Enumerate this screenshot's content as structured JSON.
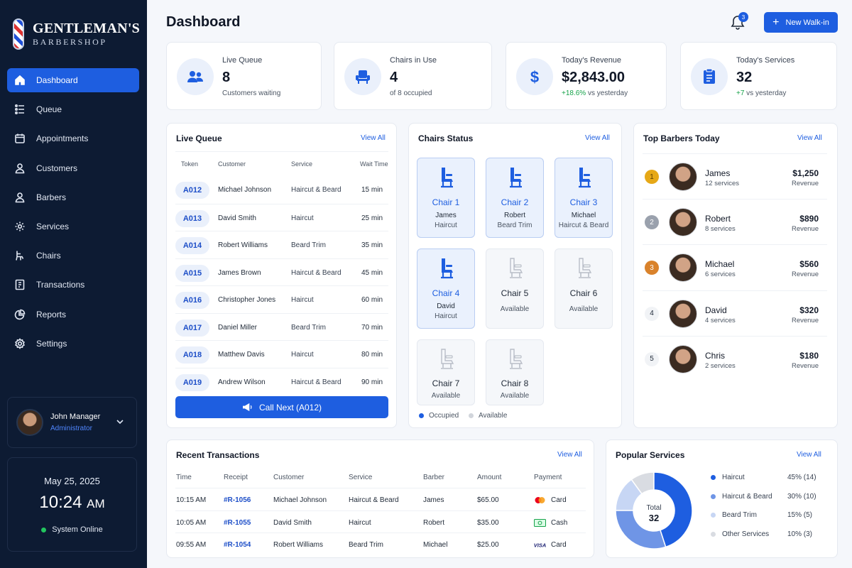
{
  "brand": {
    "title": "GENTLEMAN'S",
    "subtitle": "BARBERSHOP"
  },
  "nav": [
    {
      "label": "Dashboard",
      "icon": "home-icon",
      "active": true
    },
    {
      "label": "Queue",
      "icon": "list-icon"
    },
    {
      "label": "Appointments",
      "icon": "calendar-icon"
    },
    {
      "label": "Customers",
      "icon": "user-icon"
    },
    {
      "label": "Barbers",
      "icon": "user-icon"
    },
    {
      "label": "Services",
      "icon": "gear-icon"
    },
    {
      "label": "Chairs",
      "icon": "chair-icon"
    },
    {
      "label": "Transactions",
      "icon": "receipt-icon"
    },
    {
      "label": "Reports",
      "icon": "pie-chart-icon"
    },
    {
      "label": "Settings",
      "icon": "settings-icon"
    }
  ],
  "user": {
    "name": "John Manager",
    "role": "Administrator"
  },
  "clock": {
    "date": "May 25, 2025",
    "time": "10:24",
    "ampm": "AM",
    "status": "System Online"
  },
  "header": {
    "title": "Dashboard",
    "notifications": "3",
    "new_button": "New Walk-in"
  },
  "stats": [
    {
      "label": "Live Queue",
      "value": "8",
      "sub": "Customers waiting"
    },
    {
      "label": "Chairs in Use",
      "value": "4",
      "sub": "of 8 occupied"
    },
    {
      "label": "Today's Revenue",
      "value": "$2,843.00",
      "sub_green": "+18.6%",
      "sub": " vs yesterday"
    },
    {
      "label": "Today's Services",
      "value": "32",
      "sub_green": "+7",
      "sub": " vs yesterday"
    }
  ],
  "queue": {
    "title": "Live Queue",
    "view_all": "View All",
    "columns": [
      "Token",
      "Customer",
      "Service",
      "Wait Time"
    ],
    "rows": [
      {
        "token": "A012",
        "customer": "Michael Johnson",
        "service": "Haircut & Beard",
        "wait": "15 min"
      },
      {
        "token": "A013",
        "customer": "David Smith",
        "service": "Haircut",
        "wait": "25 min"
      },
      {
        "token": "A014",
        "customer": "Robert Williams",
        "service": "Beard Trim",
        "wait": "35 min"
      },
      {
        "token": "A015",
        "customer": "James Brown",
        "service": "Haircut & Beard",
        "wait": "45 min"
      },
      {
        "token": "A016",
        "customer": "Christopher Jones",
        "service": "Haircut",
        "wait": "60 min"
      },
      {
        "token": "A017",
        "customer": "Daniel Miller",
        "service": "Beard Trim",
        "wait": "70 min"
      },
      {
        "token": "A018",
        "customer": "Matthew Davis",
        "service": "Haircut",
        "wait": "80 min"
      },
      {
        "token": "A019",
        "customer": "Andrew Wilson",
        "service": "Haircut & Beard",
        "wait": "90 min"
      }
    ],
    "call_next": "Call Next (A012)"
  },
  "chairs": {
    "title": "Chairs Status",
    "view_all": "View All",
    "items": [
      {
        "name": "Chair 1",
        "line1": "James",
        "line2": "Haircut",
        "occupied": true
      },
      {
        "name": "Chair 2",
        "line1": "Robert",
        "line2": "Beard Trim",
        "occupied": true
      },
      {
        "name": "Chair 3",
        "line1": "Michael",
        "line2": "Haircut & Beard",
        "occupied": true
      },
      {
        "name": "Chair 4",
        "line1": "David",
        "line2": "Haircut",
        "occupied": true
      },
      {
        "name": "Chair 5",
        "line1": "Available",
        "occupied": false
      },
      {
        "name": "Chair 6",
        "line1": "Available",
        "occupied": false
      },
      {
        "name": "Chair 7",
        "line1": "Available",
        "occupied": false
      },
      {
        "name": "Chair 8",
        "line1": "Available",
        "occupied": false
      }
    ],
    "legend": {
      "occupied": "Occupied",
      "available": "Available"
    }
  },
  "barbers": {
    "title": "Top Barbers Today",
    "view_all": "View All",
    "rows": [
      {
        "rank": "1",
        "name": "James",
        "services": "12 services",
        "revenue": "$1,250",
        "revenue_label": "Revenue"
      },
      {
        "rank": "2",
        "name": "Robert",
        "services": "8 services",
        "revenue": "$890",
        "revenue_label": "Revenue"
      },
      {
        "rank": "3",
        "name": "Michael",
        "services": "6 services",
        "revenue": "$560",
        "revenue_label": "Revenue"
      },
      {
        "rank": "4",
        "name": "David",
        "services": "4 services",
        "revenue": "$320",
        "revenue_label": "Revenue"
      },
      {
        "rank": "5",
        "name": "Chris",
        "services": "2 services",
        "revenue": "$180",
        "revenue_label": "Revenue"
      }
    ]
  },
  "transactions": {
    "title": "Recent Transactions",
    "view_all": "View All",
    "columns": [
      "Time",
      "Receipt",
      "Customer",
      "Service",
      "Barber",
      "Amount",
      "Payment"
    ],
    "rows": [
      {
        "time": "10:15 AM",
        "receipt": "#R-1056",
        "customer": "Michael Johnson",
        "service": "Haircut & Beard",
        "barber": "James",
        "amount": "$65.00",
        "payment": "Card",
        "pay_icon": "mastercard-icon"
      },
      {
        "time": "10:05 AM",
        "receipt": "#R-1055",
        "customer": "David Smith",
        "service": "Haircut",
        "barber": "Robert",
        "amount": "$35.00",
        "payment": "Cash",
        "pay_icon": "cash-icon"
      },
      {
        "time": "09:55 AM",
        "receipt": "#R-1054",
        "customer": "Robert Williams",
        "service": "Beard Trim",
        "barber": "Michael",
        "amount": "$25.00",
        "payment": "Card",
        "pay_icon": "visa-icon"
      }
    ]
  },
  "popular": {
    "title": "Popular Services",
    "view_all": "View All",
    "center_label": "Total",
    "center_value": "32",
    "items": [
      {
        "name": "Haircut",
        "value": "45% (14)",
        "pct": 45,
        "color": "#1e5ee0"
      },
      {
        "name": "Haircut & Beard",
        "value": "30% (10)",
        "pct": 30,
        "color": "#6f95e6"
      },
      {
        "name": "Beard Trim",
        "value": "15% (5)",
        "pct": 15,
        "color": "#c7d6f4"
      },
      {
        "name": "Other Services",
        "value": "10% (3)",
        "pct": 10,
        "color": "#d9dce2"
      }
    ]
  }
}
